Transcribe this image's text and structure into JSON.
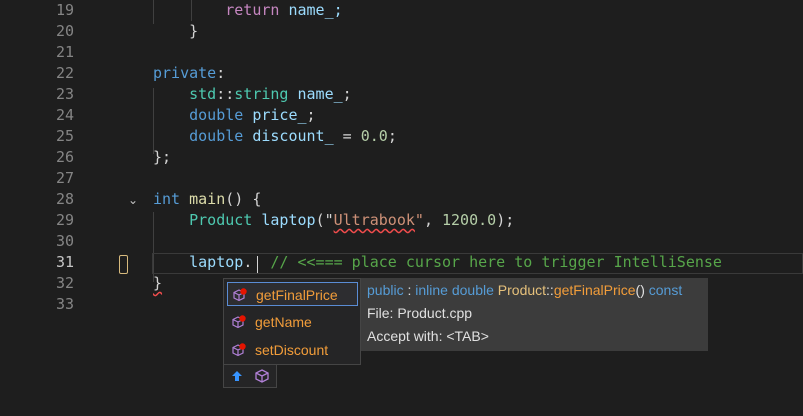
{
  "editor": {
    "lines": [
      {
        "num": "19",
        "segments": [
          {
            "t": "        ",
            "c": ""
          },
          {
            "t": "return",
            "c": "kw2"
          },
          {
            "t": " name_;",
            "c": "var"
          }
        ]
      },
      {
        "num": "20",
        "segments": [
          {
            "t": "    }",
            "c": ""
          }
        ]
      },
      {
        "num": "21",
        "segments": []
      },
      {
        "num": "22",
        "segments": [
          {
            "t": "private",
            "c": "kw"
          },
          {
            "t": ":",
            "c": ""
          }
        ]
      },
      {
        "num": "23",
        "segments": [
          {
            "t": "    std",
            "c": "ns"
          },
          {
            "t": "::",
            "c": ""
          },
          {
            "t": "string",
            "c": "ty"
          },
          {
            "t": " name_",
            "c": "var"
          },
          {
            "t": ";",
            "c": ""
          }
        ]
      },
      {
        "num": "24",
        "segments": [
          {
            "t": "    double",
            "c": "kw"
          },
          {
            "t": " price_",
            "c": "var"
          },
          {
            "t": ";",
            "c": ""
          }
        ]
      },
      {
        "num": "25",
        "segments": [
          {
            "t": "    double",
            "c": "kw"
          },
          {
            "t": " discount_",
            "c": "var"
          },
          {
            "t": " = ",
            "c": ""
          },
          {
            "t": "0.0",
            "c": "num"
          },
          {
            "t": ";",
            "c": ""
          }
        ]
      },
      {
        "num": "26",
        "segments": [
          {
            "t": "};",
            "c": ""
          }
        ]
      },
      {
        "num": "27",
        "segments": []
      },
      {
        "num": "28",
        "segments": [
          {
            "t": "int",
            "c": "kw"
          },
          {
            "t": " main",
            "c": "fn"
          },
          {
            "t": "() {",
            "c": ""
          }
        ]
      },
      {
        "num": "29",
        "segments": [
          {
            "t": "    Product",
            "c": "ty"
          },
          {
            "t": " laptop",
            "c": "var"
          },
          {
            "t": "(\"",
            "c": ""
          },
          {
            "t": "Ultrabook",
            "c": "str squig"
          },
          {
            "t": "\"",
            "c": "str"
          },
          {
            "t": ", ",
            "c": ""
          },
          {
            "t": "1200.0",
            "c": "num"
          },
          {
            "t": ");",
            "c": ""
          }
        ]
      },
      {
        "num": "30",
        "segments": []
      },
      {
        "num": "31",
        "segments": [
          {
            "t": "    laptop",
            "c": "var"
          },
          {
            "t": ". ",
            "c": ""
          },
          {
            "t": " // <<=== place cursor here to trigger IntelliSense",
            "c": "cmt"
          }
        ]
      },
      {
        "num": "32",
        "segments": [
          {
            "t": "}",
            "c": "squig"
          }
        ]
      },
      {
        "num": "33",
        "segments": []
      }
    ],
    "active_line": "31"
  },
  "completion": {
    "items": [
      {
        "label": "getFinalPrice",
        "icon": "method-icon",
        "selected": true
      },
      {
        "label": "getName",
        "icon": "method-icon",
        "selected": false
      },
      {
        "label": "setDiscount",
        "icon": "method-icon",
        "selected": false
      }
    ],
    "filters": [
      "arrow-up-icon",
      "cube-icon"
    ]
  },
  "tooltip": {
    "sig_public": "public",
    "sig_colon": " : ",
    "sig_inline": "inline",
    "sig_double": " double ",
    "sig_class": "Product",
    "sig_sep": "::",
    "sig_fn": "getFinalPrice",
    "sig_parens": "() ",
    "sig_const": "const",
    "file": "File: Product.cpp",
    "accept": "Accept with: <TAB>"
  }
}
